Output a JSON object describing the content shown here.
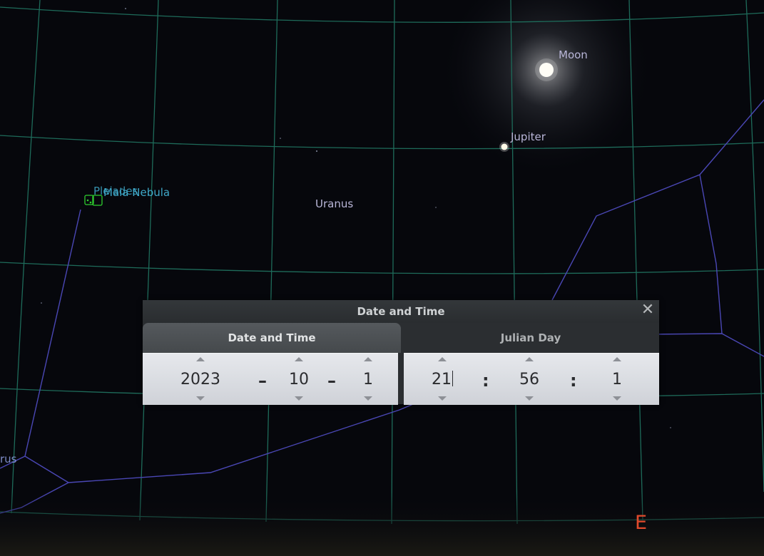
{
  "sky": {
    "labels": {
      "moon": "Moon",
      "jupiter": "Jupiter",
      "uranus": "Uranus",
      "pleiades": "Pleiades",
      "maia_nebula": "Maia Nebula",
      "constellation_partial": "rus"
    },
    "cardinal_east": "E",
    "colors": {
      "grid": "#1e6b5a",
      "constellation_lines": "#4a47b5",
      "planet_label": "#b9b6d8",
      "dso_label": "#3fa8c8",
      "dso_marker": "#2fcf2f",
      "cardinal": "#e04a2c"
    }
  },
  "dialog": {
    "title": "Date and Time",
    "close_icon": "close-icon",
    "tabs": [
      {
        "label": "Date and Time",
        "active": true
      },
      {
        "label": "Julian Day",
        "active": false
      }
    ],
    "date": {
      "year": "2023",
      "month": "10",
      "day": "1",
      "separator": "–"
    },
    "time": {
      "hour": "21",
      "minute": "56",
      "second": "1",
      "separator": ":"
    }
  }
}
